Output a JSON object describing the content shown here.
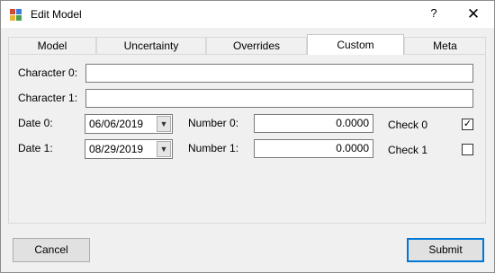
{
  "window": {
    "title": "Edit Model",
    "help_symbol": "?",
    "close_symbol": "✕"
  },
  "tabs": [
    {
      "label": "Model"
    },
    {
      "label": "Uncertainty"
    },
    {
      "label": "Overrides"
    },
    {
      "label": "Custom",
      "active": true
    },
    {
      "label": "Meta"
    }
  ],
  "custom": {
    "character0": {
      "label": "Character 0:",
      "value": ""
    },
    "character1": {
      "label": "Character 1:",
      "value": ""
    },
    "date0": {
      "label": "Date 0:",
      "value": "06/06/2019"
    },
    "date1": {
      "label": "Date 1:",
      "value": "08/29/2019"
    },
    "number0": {
      "label": "Number 0:",
      "value": "0.0000"
    },
    "number1": {
      "label": "Number 1:",
      "value": "0.0000"
    },
    "check0": {
      "label": "Check 0",
      "checked": true,
      "mark": "✓"
    },
    "check1": {
      "label": "Check 1",
      "checked": false
    }
  },
  "buttons": {
    "cancel": "Cancel",
    "submit": "Submit"
  },
  "icons": {
    "app": "app-icon",
    "dropdown": "chevron-down-icon"
  },
  "colors": {
    "accent": "#0078d7",
    "window_bg": "#f0f0f0"
  }
}
